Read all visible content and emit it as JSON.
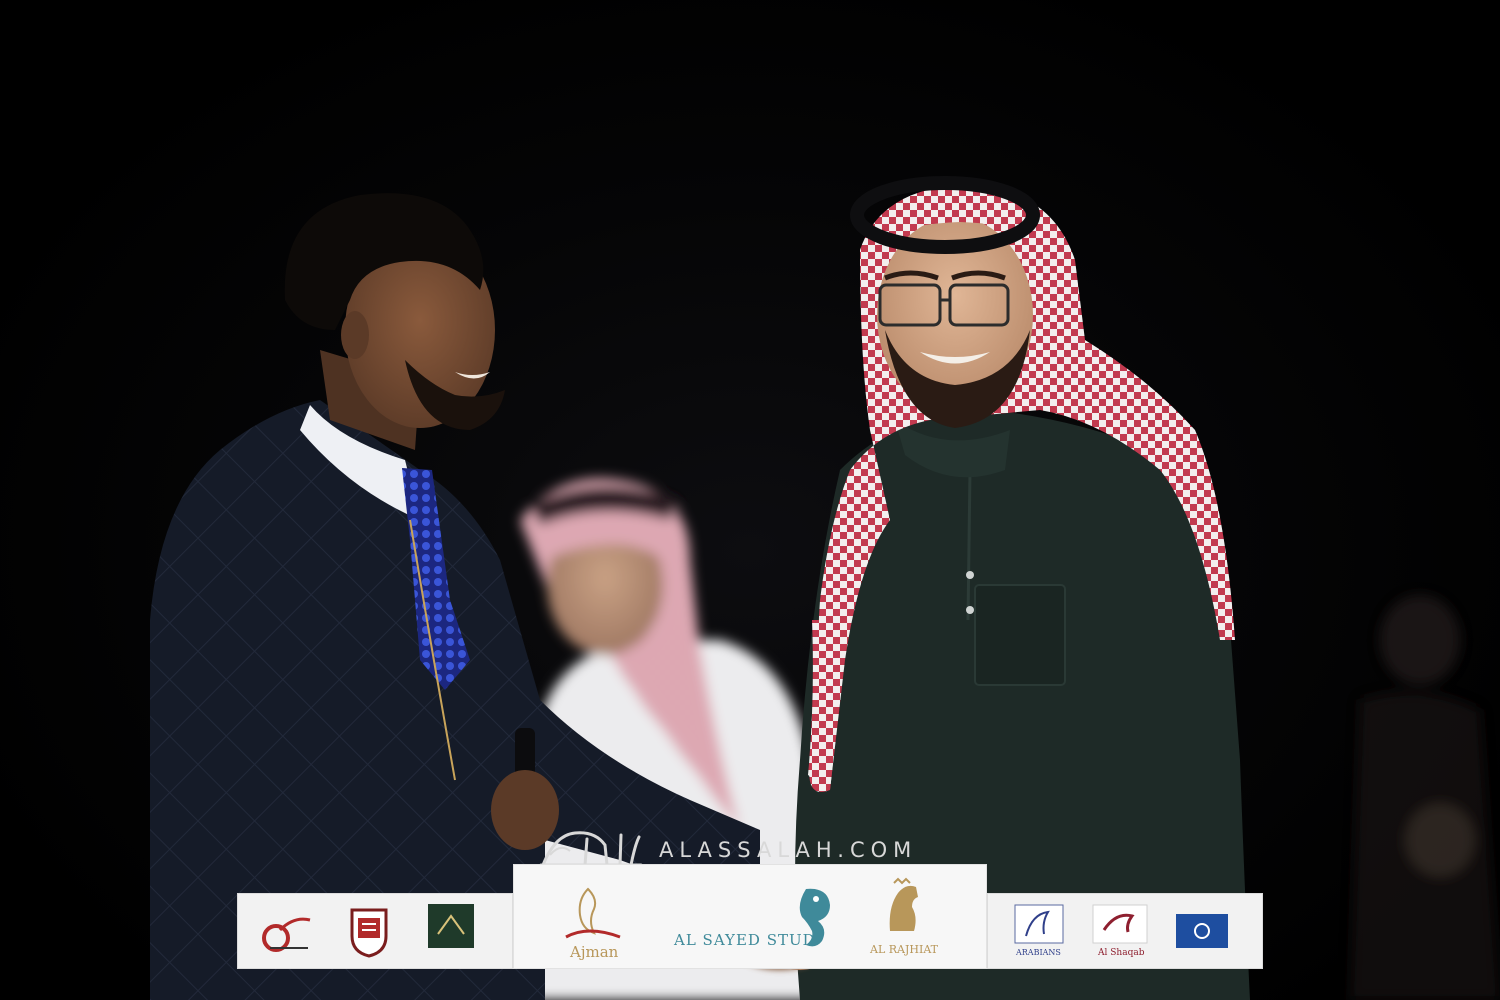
{
  "watermark": {
    "text": "ALASSALAH.COM"
  },
  "sponsors": {
    "left": [
      {
        "icon": "samjad-logo-icon"
      },
      {
        "icon": "crest-emblem-icon"
      },
      {
        "icon": "akmal-logo-icon"
      }
    ],
    "center": [
      {
        "icon": "ajman-logo-icon",
        "label": "Ajman"
      },
      {
        "icon": "seahorse-logo-icon",
        "label_en": "AL SAYED STUD"
      },
      {
        "icon": "horse-head-logo-icon",
        "label": "AL RAJHIAT"
      }
    ],
    "right": [
      {
        "icon": "aryan-logo-icon",
        "label": "ARABIANS"
      },
      {
        "icon": "al-shaqab-logo-icon",
        "label": "Al Shaqab"
      },
      {
        "icon": "blue-badge-logo-icon"
      }
    ]
  },
  "colors": {
    "gold": "#b8975a",
    "teal": "#3f8a9a",
    "headscarf_red": "#c23a4f",
    "thobe_green": "#1e2a27",
    "jacket_navy": "#141a26",
    "tie_blue": "#2b3fb5"
  }
}
